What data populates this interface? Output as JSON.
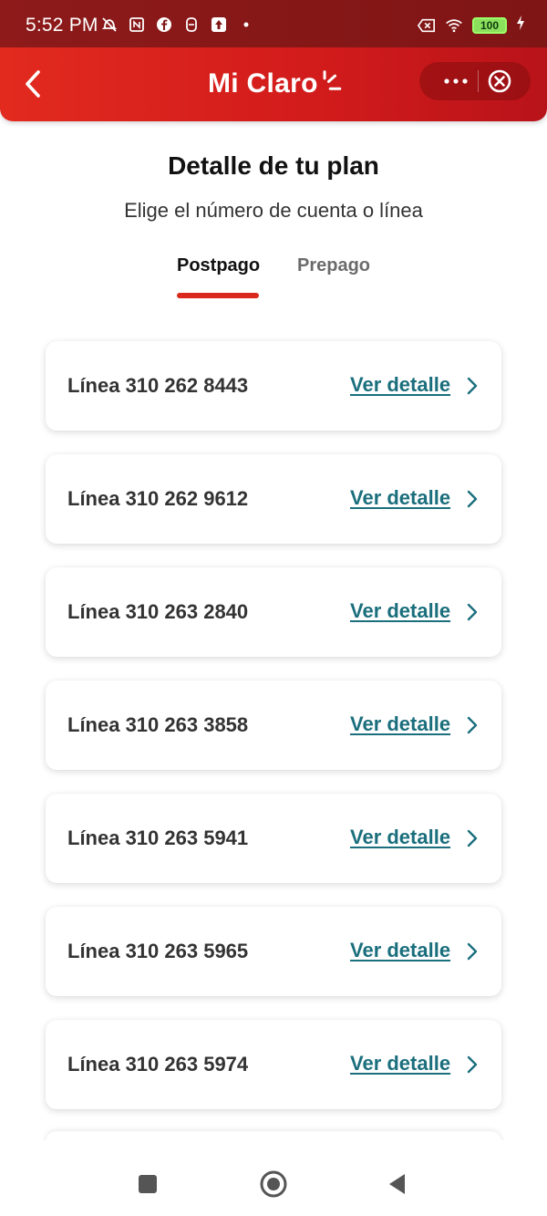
{
  "status_bar": {
    "time": "5:52 PM",
    "battery_level": "100",
    "left_icons": [
      "muted-alarm-icon",
      "nfc-icon",
      "facebook-icon",
      "app-icon",
      "upload-icon",
      "dot-icon"
    ],
    "right_icons": [
      "sim-x-icon",
      "wifi-icon",
      "battery-icon",
      "charging-icon"
    ]
  },
  "header": {
    "brand": "Mi Claro",
    "colors": {
      "primary": "#da291c",
      "dark": "#8e1a1a"
    }
  },
  "page": {
    "title": "Detalle de tu plan",
    "subtitle": "Elige el número de cuenta o línea"
  },
  "tabs": [
    {
      "label": "Postpago",
      "active": true
    },
    {
      "label": "Prepago",
      "active": false
    }
  ],
  "lines": [
    {
      "label": "Línea 310 262 8443",
      "link": "Ver detalle"
    },
    {
      "label": "Línea 310 262 9612",
      "link": "Ver detalle"
    },
    {
      "label": "Línea 310 263 2840",
      "link": "Ver detalle"
    },
    {
      "label": "Línea 310 263 3858",
      "link": "Ver detalle"
    },
    {
      "label": "Línea 310 263 5941",
      "link": "Ver detalle"
    },
    {
      "label": "Línea 310 263 5965",
      "link": "Ver detalle"
    },
    {
      "label": "Línea 310 263 5974",
      "link": "Ver detalle"
    }
  ],
  "link_color": "#1b6f7d",
  "nav_icons": [
    "recents-square-icon",
    "home-circle-icon",
    "back-triangle-icon"
  ]
}
